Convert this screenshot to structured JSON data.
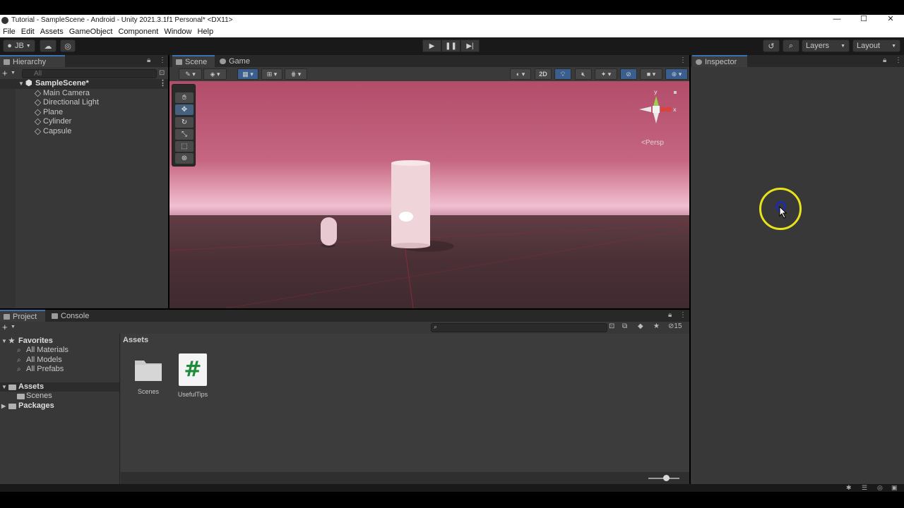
{
  "window": {
    "title": "Tutorial - SampleScene - Android - Unity 2021.3.1f1 Personal* <DX11>",
    "controls": [
      "—",
      "☐",
      "✕"
    ]
  },
  "menu": [
    "File",
    "Edit",
    "Assets",
    "GameObject",
    "Component",
    "Window",
    "Help"
  ],
  "toolbar": {
    "account": "JB",
    "layers": "Layers",
    "layout": "Layout"
  },
  "hierarchy": {
    "tab": "Hierarchy",
    "search_placeholder": "All",
    "scene": "SampleScene*",
    "items": [
      "Main Camera",
      "Directional Light",
      "Plane",
      "Cylinder",
      "Capsule"
    ]
  },
  "scene_view": {
    "tabs": [
      "Scene",
      "Game"
    ],
    "toggle_2d": "2D",
    "gizmo_label": "<Persp",
    "axes": {
      "x": "x",
      "y": "y"
    }
  },
  "inspector": {
    "tab": "Inspector"
  },
  "project": {
    "tabs": [
      "Project",
      "Console"
    ],
    "favorites": {
      "label": "Favorites",
      "items": [
        "All Materials",
        "All Models",
        "All Prefabs"
      ]
    },
    "assets_root": "Assets",
    "assets_children": [
      "Scenes"
    ],
    "packages": "Packages",
    "breadcrumb": "Assets",
    "hidden_count": "15",
    "items": [
      {
        "name": "Scenes",
        "type": "folder"
      },
      {
        "name": "UsefulTips",
        "type": "script",
        "glyph": "#"
      }
    ]
  },
  "colors": {
    "accent": "#3a72b0",
    "sky_top": "#b24d6a",
    "horizon": "#f1bfd0",
    "ground": "#4a3036",
    "cursor_ring": "#e8e21a"
  }
}
